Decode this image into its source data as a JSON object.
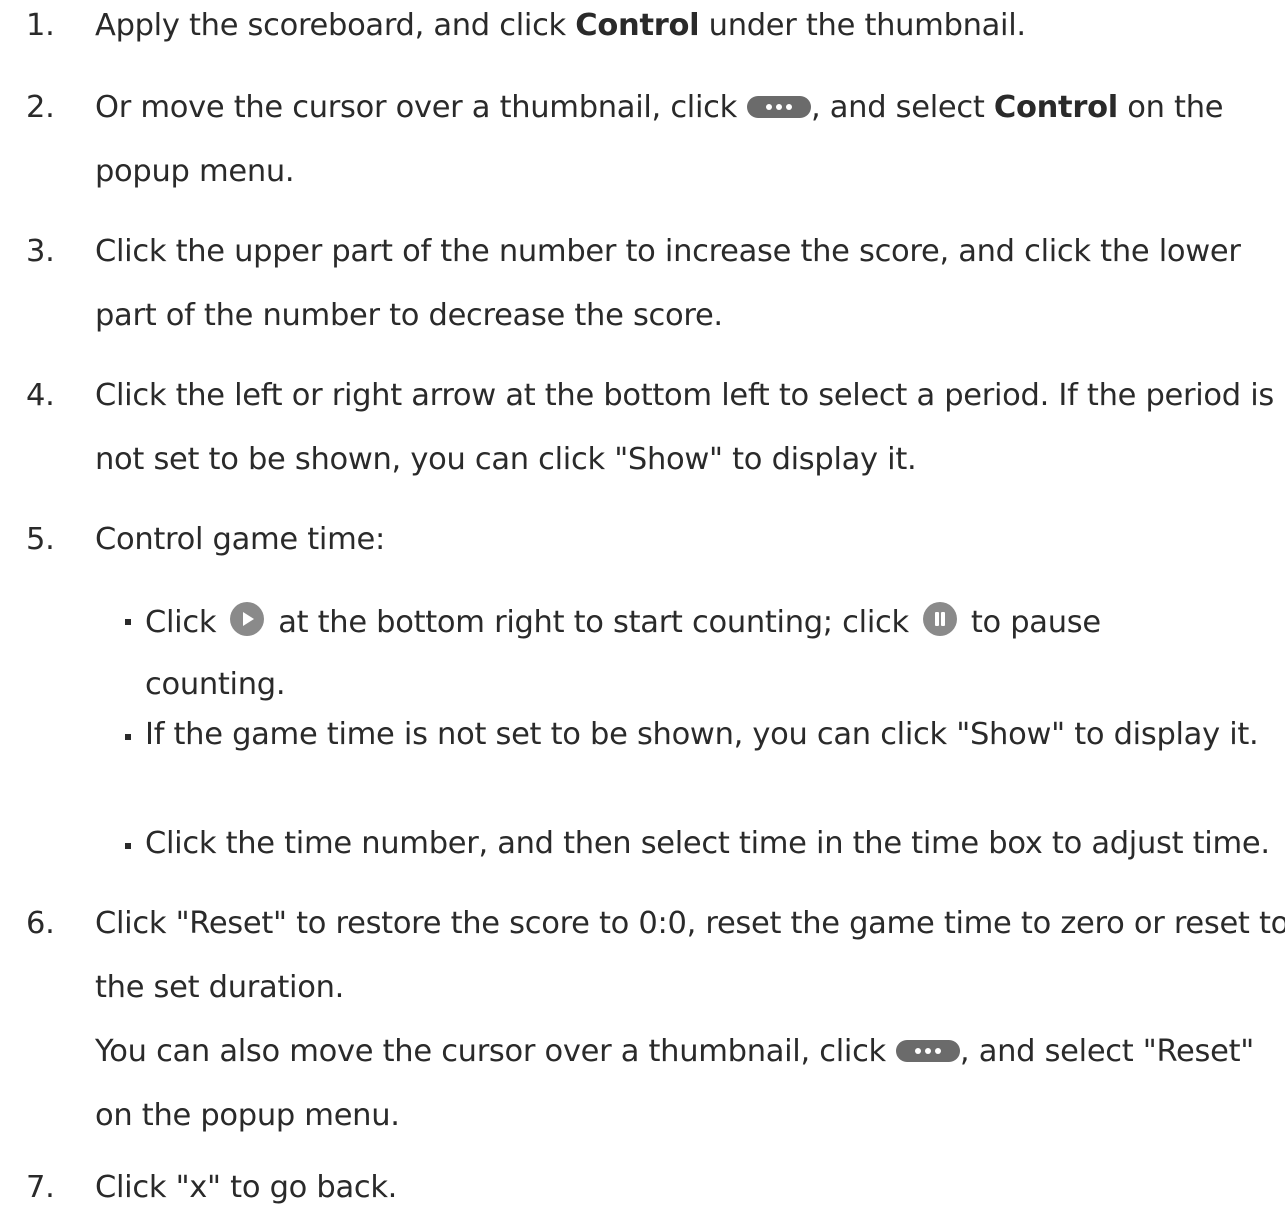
{
  "steps": [
    {
      "num": "1.",
      "pre": "Apply the scoreboard, and click ",
      "bold": "Control",
      "post": " under the thumbnail."
    },
    {
      "num": "2.",
      "pre": "Or move the cursor over a thumbnail, click",
      "mid": ", and select ",
      "bold": "Control",
      "post": " on the",
      "line2": "popup menu."
    },
    {
      "num": "3.",
      "line1": "Click the upper part of the number to increase the score, and click the lower",
      "line2": "part of the number to decrease the score."
    },
    {
      "num": "4.",
      "line1": "Click the left or right arrow at the bottom left to select a period. If the period is",
      "line2": "not set to be shown, you can click \"Show\" to display it."
    },
    {
      "num": "5.",
      "line1": "Control game time:"
    },
    {
      "num": "6.",
      "line1": "Click \"Reset\" to restore the score to 0:0, reset the game time to zero or reset to",
      "line2": "the set duration.",
      "line3_pre": "You can also move the cursor over a thumbnail, click",
      "line3_post": ", and select \"Reset\"",
      "line4": "on the popup menu."
    },
    {
      "num": "7.",
      "line1": "Click \"x\" to go back."
    }
  ],
  "sub_bullets": [
    {
      "pre": "Click",
      "mid": "at the bottom right to start counting; click",
      "post": "to pause",
      "line2": "counting."
    },
    {
      "line1": "If the game time is not set to be shown, you can click \"Show\" to display it."
    },
    {
      "line1": "Click the time number, and then select time in the time box to adjust time."
    }
  ],
  "icons": {
    "more": "more-options-icon",
    "play": "play-icon",
    "pause": "pause-icon"
  },
  "colors": {
    "text": "#2a2a2a",
    "icon_dark": "#6b6b6b",
    "icon_light": "#8a8a8a"
  }
}
